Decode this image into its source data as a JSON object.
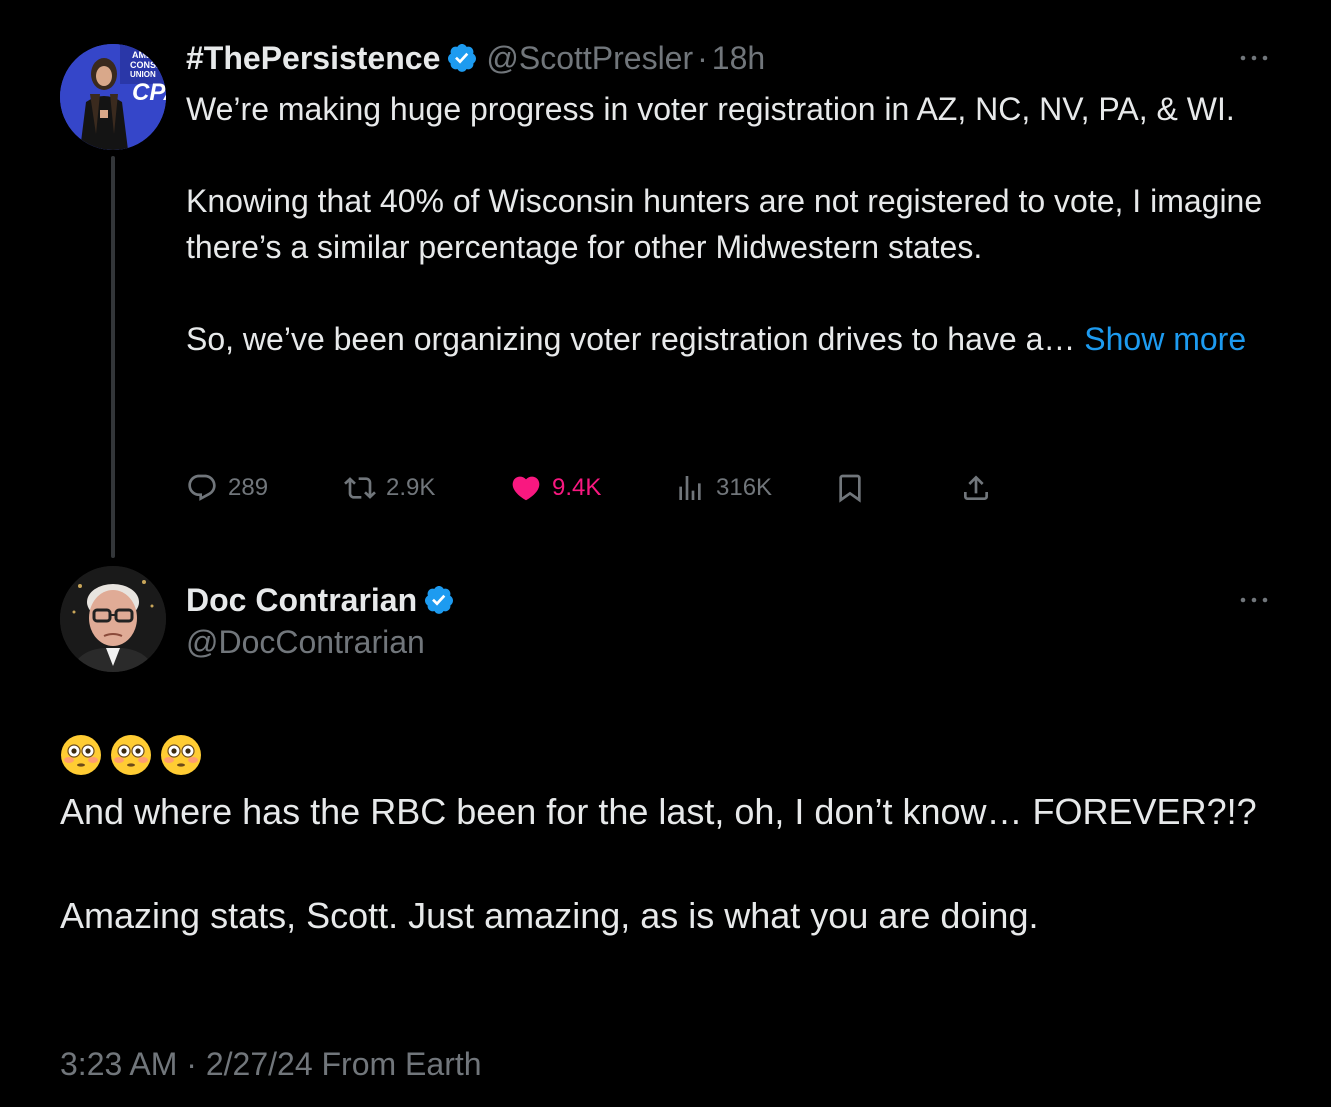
{
  "colors": {
    "background": "#000000",
    "text": "#e7e9ea",
    "muted": "#71767b",
    "link": "#1d9bf0",
    "like": "#f91880",
    "verified": "#1d9bf0",
    "thread_line": "#333639"
  },
  "tweet1": {
    "display_name": "#ThePersistence",
    "handle": "@ScottPresler",
    "separator": "·",
    "time": "18h",
    "text_main": "We’re making huge progress in voter registration in AZ, NC, NV, PA, & WI.\n\nKnowing that 40% of Wisconsin hunters are not registered to vote, I imagine there’s a similar percentage for other Midwestern states.\n\nSo, we’ve been organizing voter registration drives to have a… ",
    "show_more": "Show more",
    "icons": {
      "more": "more-dots-icon",
      "verified": "verified-badge-icon",
      "reply": "reply-icon",
      "retweet": "retweet-icon",
      "like": "like-heart-icon",
      "views": "views-chart-icon",
      "bookmark": "bookmark-icon",
      "share": "share-icon"
    },
    "stats": {
      "replies": "289",
      "retweets": "2.9K",
      "likes": "9.4K",
      "views": "316K"
    },
    "liked": true
  },
  "tweet2": {
    "display_name": "Doc Contrarian",
    "handle": "@DocContrarian",
    "emojis": [
      "flushed-face",
      "flushed-face",
      "flushed-face"
    ],
    "text": "And where has the RBC been for the last, oh, I don’t know… FOREVER?!?\n\nAmazing stats, Scott. Just amazing, as is what you are doing.",
    "timestamp": "3:23 AM · 2/27/24 From Earth"
  }
}
